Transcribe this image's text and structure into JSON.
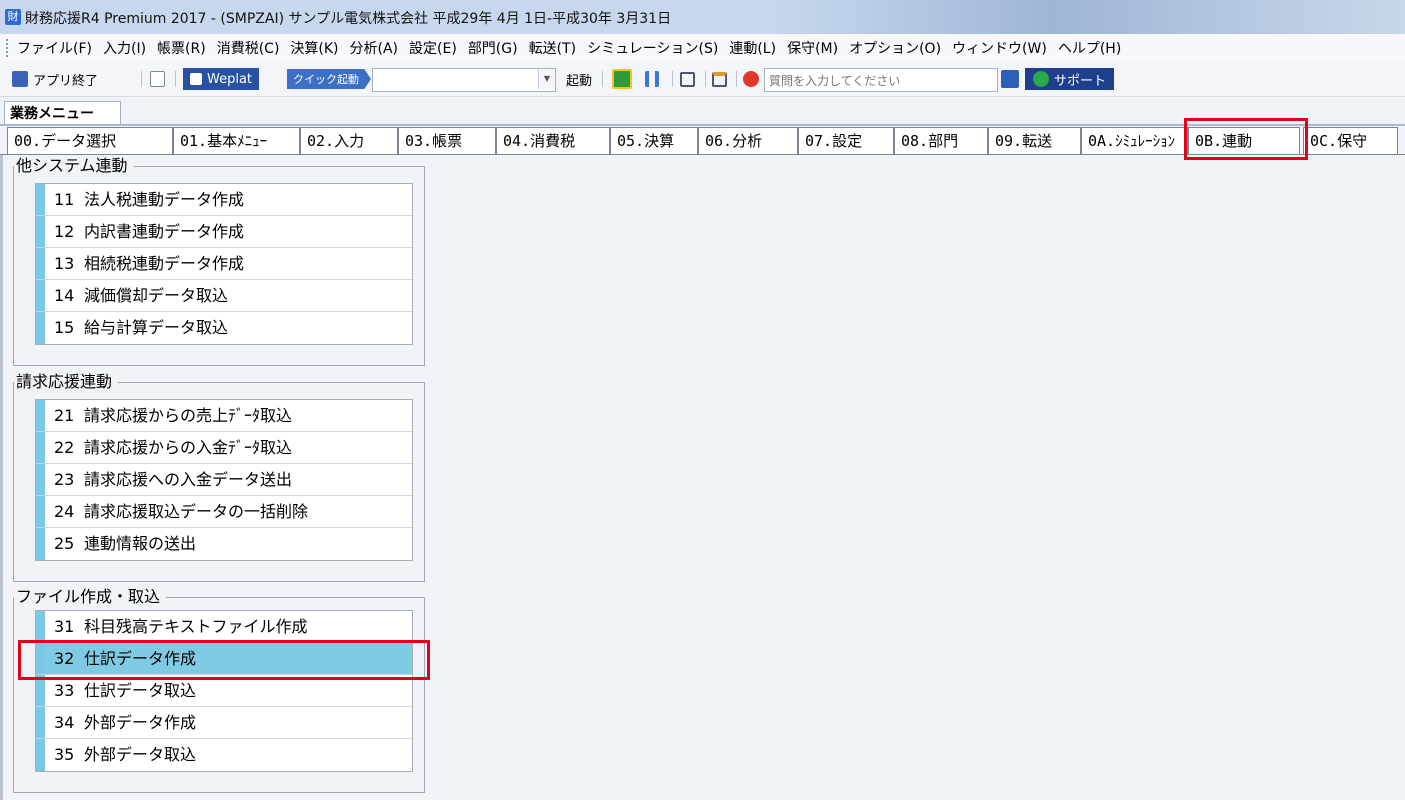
{
  "window": {
    "app_icon_glyph": "財",
    "title": "財務応援R4 Premium 2017 - (SMPZAI) サンプル電気株式会社 平成29年 4月 1日-平成30年 3月31日"
  },
  "menu": [
    "ファイル(F)",
    "入力(I)",
    "帳票(R)",
    "消費税(C)",
    "決算(K)",
    "分析(A)",
    "設定(E)",
    "部門(G)",
    "転送(T)",
    "シミュレーション(S)",
    "連動(L)",
    "保守(M)",
    "オプション(O)",
    "ウィンドウ(W)",
    "ヘルプ(H)"
  ],
  "toolbar": {
    "exit_label": "アプリ終了",
    "weplat_label": "Weplat",
    "quick_label": "クイック起動",
    "launch_label": "起動",
    "question_placeholder": "質問を入力してください",
    "support_label": "サポート"
  },
  "gyomu_tab": "業務メニュー",
  "tabs": [
    "00.データ選択",
    "01.基本ﾒﾆｭｰ",
    "02.入力",
    "03.帳票",
    "04.消費税",
    "05.決算",
    "06.分析",
    "07.設定",
    "08.部門",
    "09.転送",
    "0A.ｼﾐｭﾚｰｼｮﾝ",
    "0B.連動",
    "0C.保守"
  ],
  "groups": [
    {
      "title": "他システム連動",
      "items": [
        {
          "num": "11",
          "label": "法人税連動データ作成"
        },
        {
          "num": "12",
          "label": "内訳書連動データ作成"
        },
        {
          "num": "13",
          "label": "相続税連動データ作成"
        },
        {
          "num": "14",
          "label": "減価償却データ取込"
        },
        {
          "num": "15",
          "label": "給与計算データ取込"
        }
      ]
    },
    {
      "title": "請求応援連動",
      "items": [
        {
          "num": "21",
          "label": "請求応援からの売上ﾃﾞｰﾀ取込"
        },
        {
          "num": "22",
          "label": "請求応援からの入金ﾃﾞｰﾀ取込"
        },
        {
          "num": "23",
          "label": "請求応援への入金データ送出"
        },
        {
          "num": "24",
          "label": "請求応援取込データの一括削除"
        },
        {
          "num": "25",
          "label": "連動情報の送出"
        }
      ]
    },
    {
      "title": "ファイル作成・取込",
      "items": [
        {
          "num": "31",
          "label": "科目残高テキストファイル作成"
        },
        {
          "num": "32",
          "label": "仕訳データ作成"
        },
        {
          "num": "33",
          "label": "仕訳データ取込"
        },
        {
          "num": "34",
          "label": "外部データ作成"
        },
        {
          "num": "35",
          "label": "外部データ取込"
        }
      ]
    }
  ],
  "colors": {
    "highlight_box": "#e3001b",
    "selected_row": "#7fcbe4",
    "row_stripe": "#7cc7e6"
  }
}
